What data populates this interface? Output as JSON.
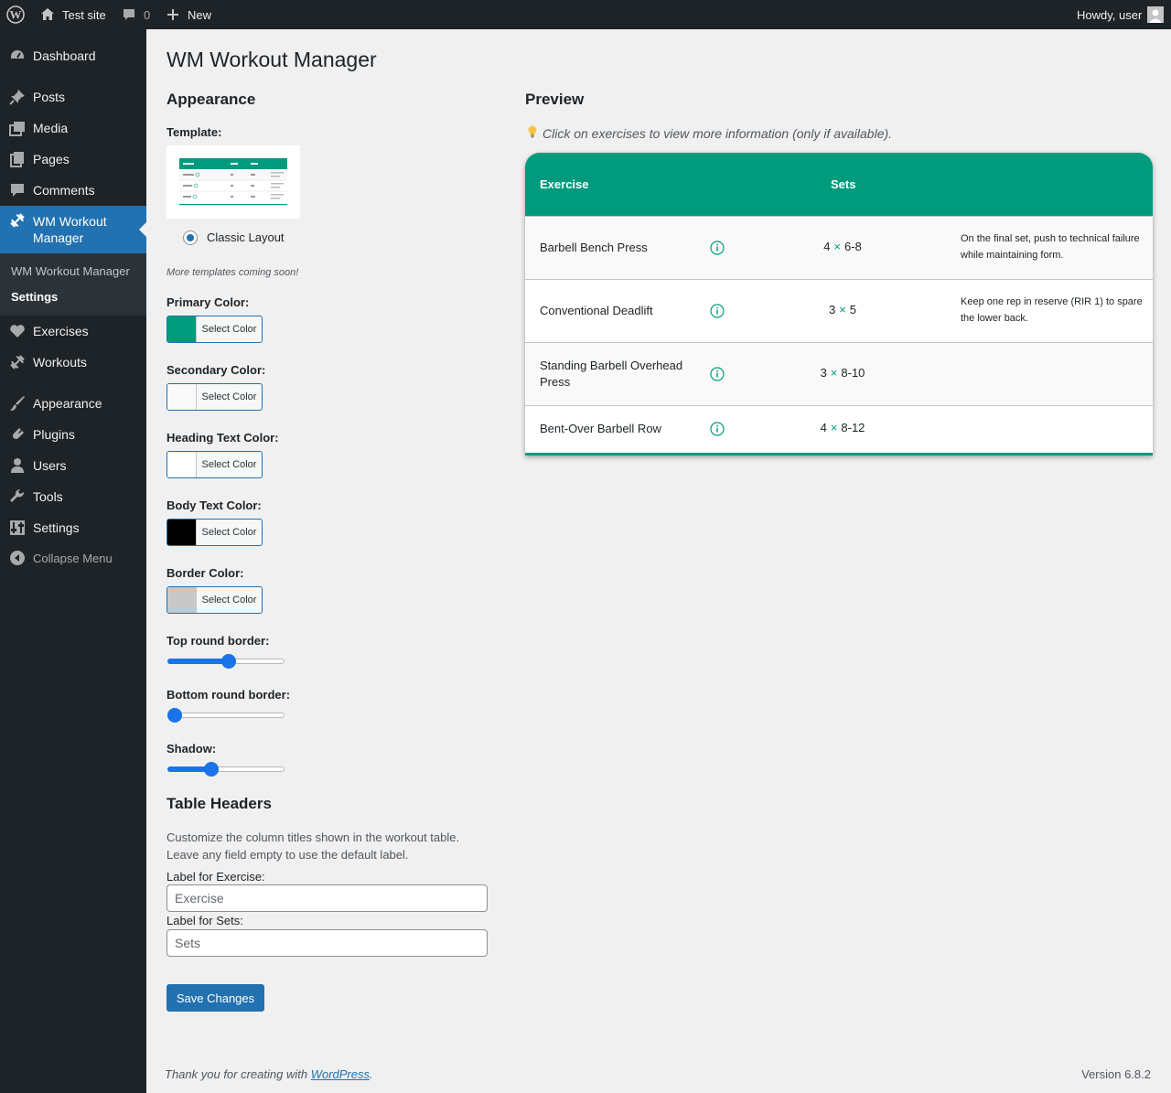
{
  "adminbar": {
    "site_name": "Test site",
    "comments_count": "0",
    "new_label": "New",
    "greeting": "Howdy, user"
  },
  "sidebar": {
    "items": [
      {
        "label": "Dashboard",
        "icon": "dashboard-icon"
      },
      {
        "label": "Posts",
        "icon": "pin-icon"
      },
      {
        "label": "Media",
        "icon": "media-icon"
      },
      {
        "label": "Pages",
        "icon": "pages-icon"
      },
      {
        "label": "Comments",
        "icon": "comments-icon"
      },
      {
        "label": "WM Workout Manager",
        "icon": "dumbbell-icon"
      },
      {
        "label": "Exercises",
        "icon": "heart-icon"
      },
      {
        "label": "Workouts",
        "icon": "dumbbell-icon"
      },
      {
        "label": "Appearance",
        "icon": "brush-icon"
      },
      {
        "label": "Plugins",
        "icon": "plugin-icon"
      },
      {
        "label": "Users",
        "icon": "user-icon"
      },
      {
        "label": "Tools",
        "icon": "wrench-icon"
      },
      {
        "label": "Settings",
        "icon": "settings-icon"
      }
    ],
    "submenu": [
      "WM Workout Manager",
      "Settings"
    ],
    "collapse": "Collapse Menu"
  },
  "page": {
    "title": "WM Workout Manager",
    "appearance_heading": "Appearance",
    "template_label": "Template:",
    "template_option": "Classic Layout",
    "templates_note": "More templates coming soon!",
    "colors": [
      {
        "label": "Primary Color:",
        "button": "Select Color",
        "value": "#009b7d"
      },
      {
        "label": "Secondary Color:",
        "button": "Select Color",
        "value": "#f9f9f9"
      },
      {
        "label": "Heading Text Color:",
        "button": "Select Color",
        "value": "#ffffff"
      },
      {
        "label": "Body Text Color:",
        "button": "Select Color",
        "value": "#000000"
      },
      {
        "label": "Border Color:",
        "button": "Select Color",
        "value": "#c8c8c8"
      }
    ],
    "sliders": [
      {
        "label": "Top round border:",
        "fraction": 0.53
      },
      {
        "label": "Bottom round border:",
        "fraction": 0.0
      },
      {
        "label": "Shadow:",
        "fraction": 0.36
      }
    ],
    "table_headers_heading": "Table Headers",
    "table_headers_desc_1": "Customize the column titles shown in the workout table.",
    "table_headers_desc_2": "Leave any field empty to use the default label.",
    "exercise_label": "Label for Exercise:",
    "exercise_placeholder": "Exercise",
    "sets_label": "Label for Sets:",
    "sets_placeholder": "Sets",
    "save_label": "Save Changes"
  },
  "preview": {
    "heading": "Preview",
    "hint": "Click on exercises to view more information (only if available).",
    "col_exercise": "Exercise",
    "col_sets": "Sets",
    "rows": [
      {
        "exercise": "Barbell Bench Press",
        "sets": "4",
        "reps": "6-8",
        "note": "On the final set, push to technical failure while maintaining form."
      },
      {
        "exercise": "Conventional Deadlift",
        "sets": "3",
        "reps": "5",
        "note": "Keep one rep in reserve (RIR 1) to spare the lower back."
      },
      {
        "exercise": "Standing Barbell Overhead Press",
        "sets": "3",
        "reps": "8-10",
        "note": ""
      },
      {
        "exercise": "Bent-Over Barbell Row",
        "sets": "4",
        "reps": "8-12",
        "note": ""
      }
    ],
    "times_symbol": "×"
  },
  "footer": {
    "thanks_prefix": "Thank you for creating with ",
    "thanks_link": "WordPress",
    "thanks_suffix": ".",
    "version": "Version 6.8.2"
  }
}
